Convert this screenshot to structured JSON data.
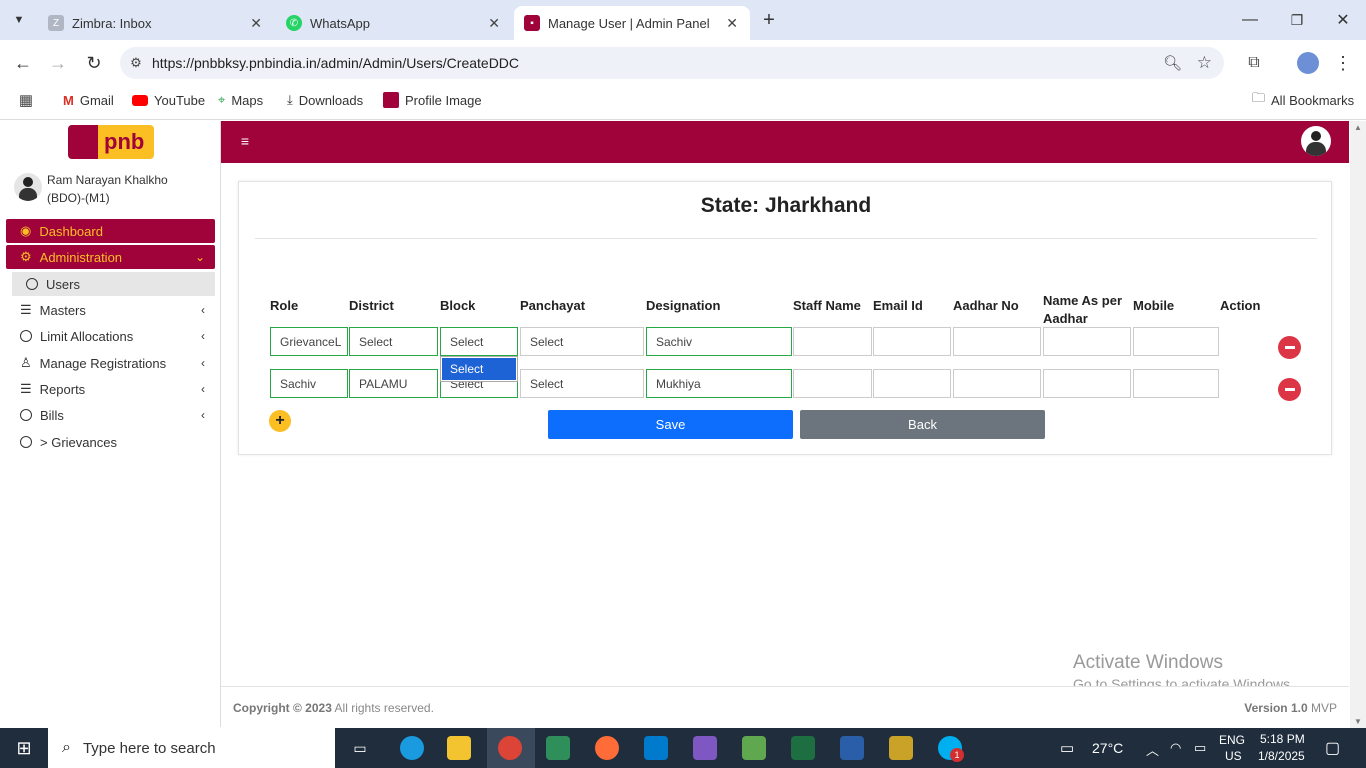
{
  "browser": {
    "tabs": [
      {
        "title": "Zimbra: Inbox",
        "active": false
      },
      {
        "title": "WhatsApp",
        "active": false
      },
      {
        "title": "Manage User | Admin Panel",
        "active": true
      }
    ],
    "url": "https://pnbbksy.pnbindia.in/admin/Admin/Users/CreateDDC",
    "bookmarks": [
      "Gmail",
      "YouTube",
      "Maps",
      "Downloads",
      "Profile Image"
    ],
    "all_bookmarks": "All Bookmarks"
  },
  "sidebar": {
    "logo_text": "pnb",
    "user_name": "Ram Narayan Khalkho",
    "user_role": "(BDO)-(M1)",
    "nav": [
      {
        "label": "Dashboard"
      },
      {
        "label": "Administration"
      },
      {
        "label": "Users"
      },
      {
        "label": "Masters"
      },
      {
        "label": "Limit Allocations"
      },
      {
        "label": "Manage Registrations"
      },
      {
        "label": "Reports"
      },
      {
        "label": "Bills"
      },
      {
        "label": "> Grievances"
      }
    ]
  },
  "main": {
    "heading": "State: Jharkhand",
    "columns": [
      "Role",
      "District",
      "Block",
      "Panchayat",
      "Designation",
      "Staff Name",
      "Email Id",
      "Aadhar No",
      "Name As per Aadhar",
      "Mobile",
      "Action"
    ],
    "rows": [
      {
        "role": "GrievanceL",
        "district": "Select",
        "block": "Select",
        "panchayat": "Select",
        "designation": "Sachiv",
        "staff": "",
        "email": "",
        "aadhar": "",
        "aadhar_name": "",
        "mobile": ""
      },
      {
        "role": "Sachiv",
        "district": "PALAMU",
        "block": "Select",
        "panchayat": "Select",
        "designation": "Mukhiya",
        "staff": "",
        "email": "",
        "aadhar": "",
        "aadhar_name": "",
        "mobile": ""
      }
    ],
    "dropdown_option": "Select",
    "save_label": "Save",
    "back_label": "Back"
  },
  "footer": {
    "copyright_bold": "Copyright © 2023",
    "copyright_rest": "All rights reserved.",
    "version_bold": "Version 1.0",
    "version_rest": "MVP"
  },
  "watermark": {
    "title": "Activate Windows",
    "subtitle": "Go to Settings to activate Windows."
  },
  "taskbar": {
    "search_placeholder": "Type here to search",
    "weather": "27°C",
    "lang_top": "ENG",
    "lang_bottom": "US",
    "time": "5:18 PM",
    "date": "1/8/2025",
    "badge": "1"
  },
  "colors": {
    "brand": "#a0033a",
    "accent": "#fbbf24",
    "primary": "#0d6efd",
    "secondary": "#6c757d",
    "danger": "#dc3545",
    "success": "#28a745"
  }
}
